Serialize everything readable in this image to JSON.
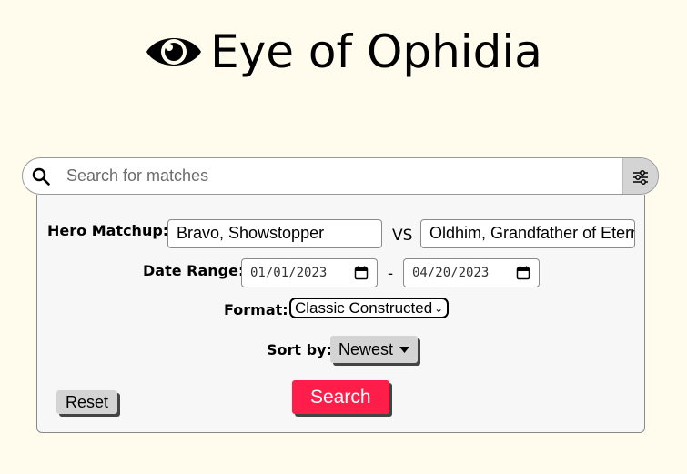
{
  "header": {
    "title": "Eye of Ophidia",
    "logo_icon": "eye-icon"
  },
  "search": {
    "placeholder": "Search for matches",
    "value": "",
    "icon": "search-icon",
    "filter_icon": "sliders-icon"
  },
  "filters": {
    "hero_matchup_label": "Hero Matchup:",
    "hero1": "Bravo, Showstopper",
    "vs_label": "VS",
    "hero2": "Oldhim, Grandfather of Eternity",
    "date_range_label": "Date Range:",
    "date_from": "01/01/2023",
    "date_separator": "-",
    "date_to": "04/20/2023",
    "format_label": "Format:",
    "format_value": "Classic Constructed",
    "sort_label": "Sort by:",
    "sort_value": "Newest",
    "reset_label": "Reset",
    "search_label": "Search"
  },
  "colors": {
    "background": "#fffcee",
    "search_button": "#ff1e4a",
    "button_gray": "#d4d4d4"
  }
}
